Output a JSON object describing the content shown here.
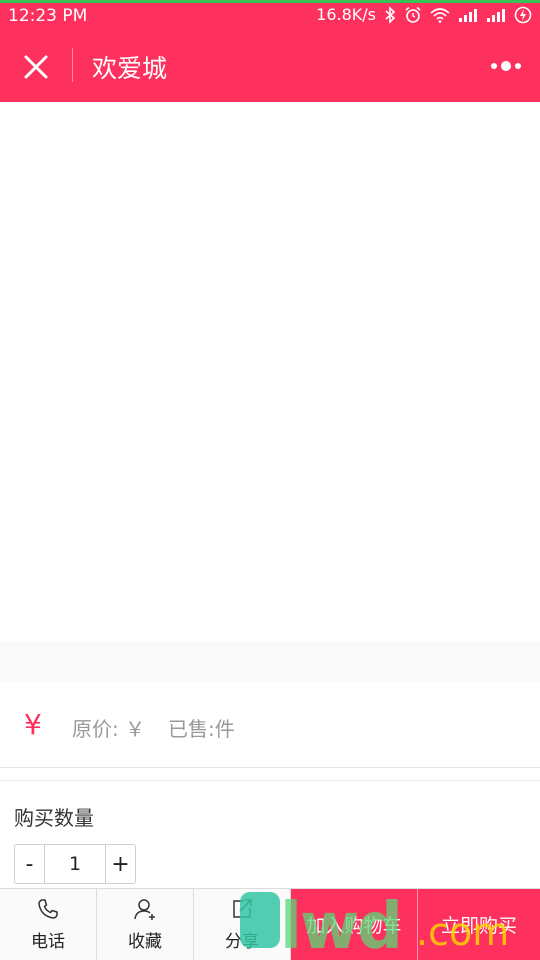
{
  "status_bar": {
    "time": "12:23 PM",
    "network_speed": "16.8K/s",
    "icons": [
      "bluetooth-icon",
      "alarm-icon",
      "wifi-icon",
      "signal-icon",
      "signal-icon",
      "battery-charging-icon"
    ]
  },
  "header": {
    "title": "欢爱城",
    "close_icon": "close-icon",
    "more_icon": "more-icon"
  },
  "product": {
    "price_symbol": "¥",
    "original_price": "原价: ￥",
    "sold": "已售:件"
  },
  "quantity": {
    "label": "购买数量",
    "minus": "-",
    "value": "1",
    "plus": "+"
  },
  "bottom_bar": {
    "phone_label": "电话",
    "favorite_label": "收藏",
    "share_label": "分享",
    "add_to_cart": "加入购物车",
    "buy_now": "立即购买"
  },
  "watermark": {
    "text": "lwd",
    "suffix": ".com"
  },
  "colors": {
    "brand": "#fd305e",
    "status_accent": "#38c155"
  }
}
